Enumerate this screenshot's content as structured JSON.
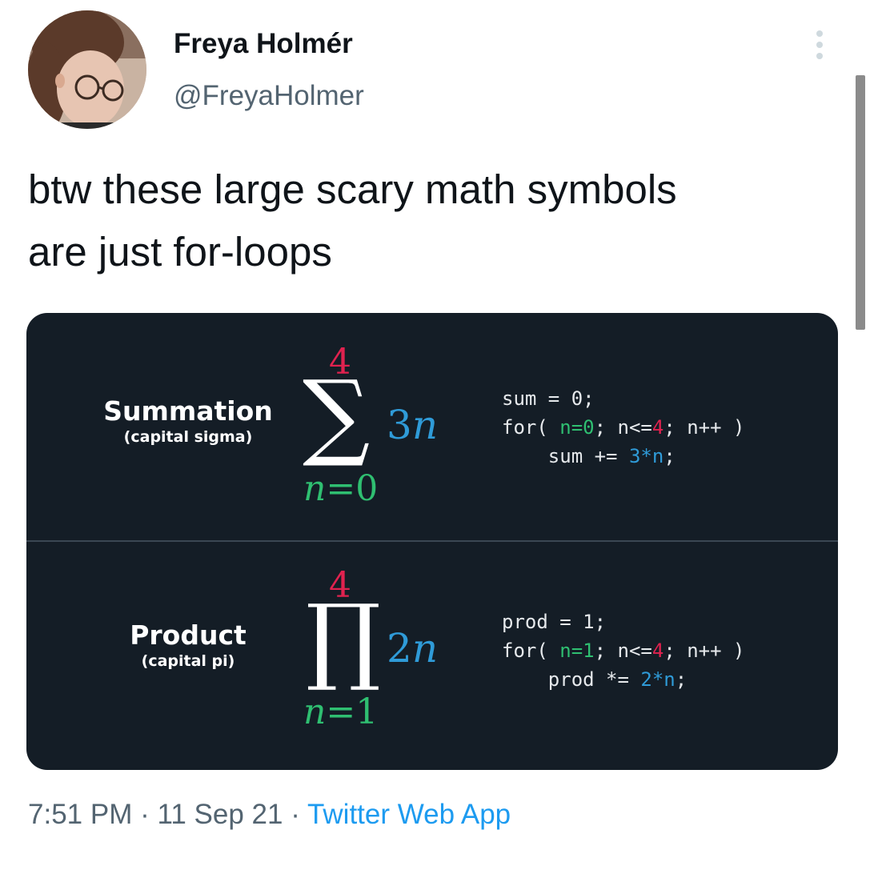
{
  "author": {
    "name": "Freya Holmér",
    "handle": "@FreyaHolmer"
  },
  "tweet": {
    "text": "btw these large scary math symbols\nare just for-loops"
  },
  "media": {
    "summation": {
      "title": "Summation",
      "subtitle": "(capital sigma)",
      "upper": "4",
      "symbol": "∑",
      "term_coef": "3",
      "term_var": "n",
      "lower_var": "n",
      "lower_eq": "=0",
      "code": {
        "line1": "sum = 0;",
        "line2_a": "for( ",
        "line2_init": "n=0",
        "line2_b": "; n<=",
        "line2_limit": "4",
        "line2_c": "; n++ )",
        "line3_a": "    sum += ",
        "line3_expr": "3*n",
        "line3_b": ";"
      }
    },
    "product": {
      "title": "Product",
      "subtitle": "(capital pi)",
      "upper": "4",
      "symbol": "∏",
      "term_coef": "2",
      "term_var": "n",
      "lower_var": "n",
      "lower_eq": "=1",
      "code": {
        "line1": "prod = 1;",
        "line2_a": "for( ",
        "line2_init": "n=1",
        "line2_b": "; n<=",
        "line2_limit": "4",
        "line2_c": "; n++ )",
        "line3_a": "    prod *= ",
        "line3_expr": "2*n",
        "line3_b": ";"
      }
    }
  },
  "footer": {
    "time": "7:51 PM",
    "sep1": " · ",
    "date": "11 Sep 21",
    "sep2": " · ",
    "source": "Twitter Web App"
  },
  "colors": {
    "accent": "#1d9bf0",
    "media_bg": "#141d26",
    "math_red": "#e0224f",
    "math_green": "#2fbf71",
    "math_blue": "#2f9bd8"
  },
  "icons": {
    "more": "more-vertical-icon"
  }
}
